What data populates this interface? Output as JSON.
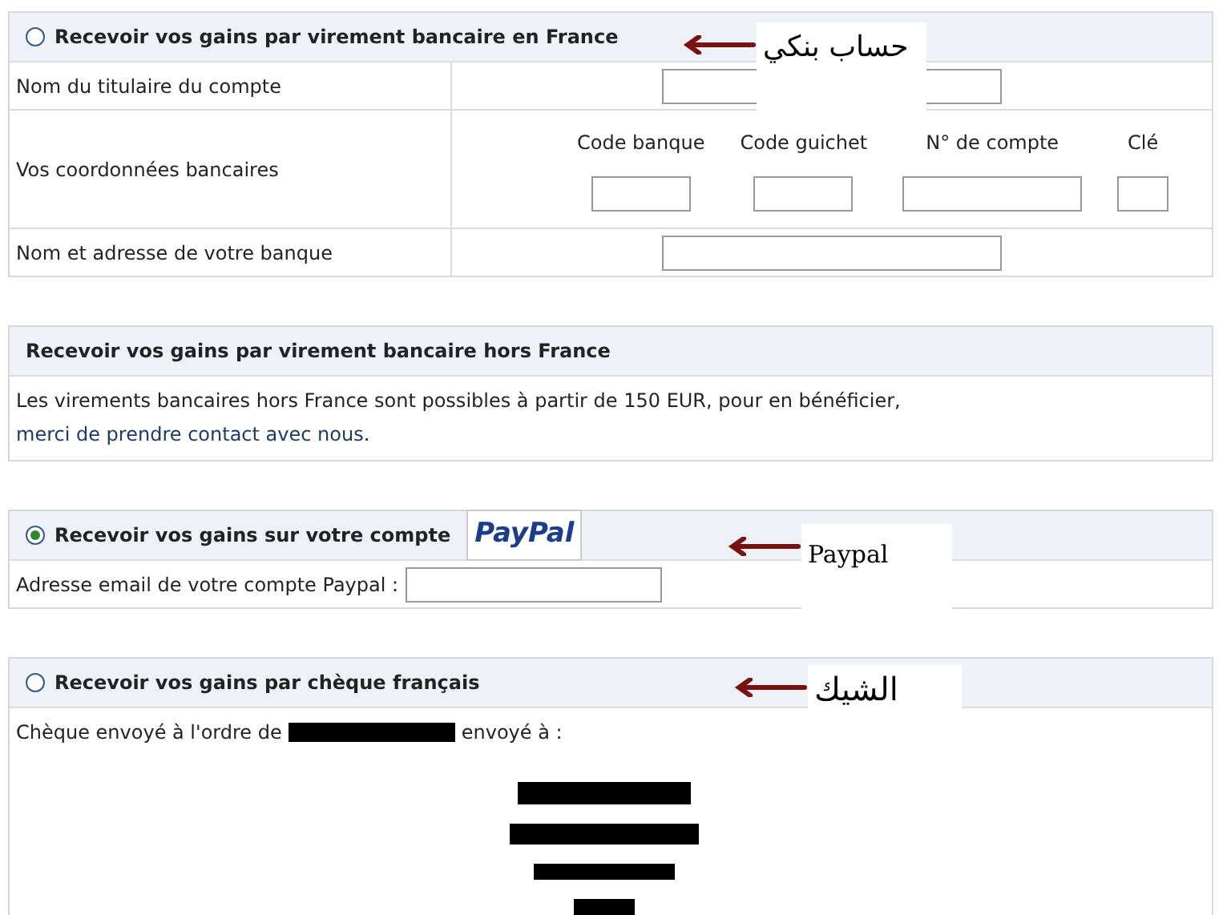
{
  "sections": [
    {
      "kind": "radio",
      "title": "Recevoir vos gains par virement bancaire en France",
      "selected": false,
      "annotation": "حساب بنكي",
      "rows": [
        {
          "kind": "field",
          "label": "Nom du titulaire du compte"
        },
        {
          "kind": "bank",
          "label": "Vos coordonnées bancaires",
          "columns": [
            "Code banque",
            "Code guichet",
            "N° de compte",
            "Clé"
          ]
        },
        {
          "kind": "field",
          "label": "Nom et adresse de votre banque"
        }
      ]
    },
    {
      "kind": "plain",
      "title": "Recevoir vos gains par virement bancaire hors France",
      "note": "Les virements bancaires hors France sont possibles à partir de 150 EUR, pour en bénéficier,",
      "link": "merci de prendre contact avec nous",
      "end": "."
    },
    {
      "kind": "radio",
      "title": "Recevoir vos gains sur votre compte",
      "selected": true,
      "logo": "PayPal",
      "annotation": "Paypal",
      "rows": [
        {
          "kind": "inline",
          "label": "Adresse email de votre compte Paypal :"
        }
      ]
    },
    {
      "kind": "radio",
      "title": "Recevoir vos gains par chèque français",
      "selected": false,
      "annotation": "الشيك",
      "cheque": {
        "before": "Chèque envoyé à l'ordre de",
        "after": "envoyé à :"
      }
    }
  ]
}
